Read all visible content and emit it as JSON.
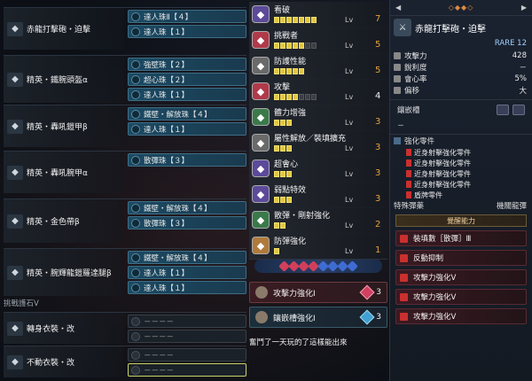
{
  "left": {
    "rows": [
      {
        "name": "赤龍打擊砲・迫擊",
        "icon": "gunlance-icon",
        "jewels": [
          {
            "label": "達人珠Ⅱ【４】",
            "empty": false
          },
          {
            "label": "達人珠【１】",
            "empty": false
          }
        ]
      },
      {
        "name": "精英・鐵腕頭盔α",
        "icon": "helm-icon",
        "jewels": [
          {
            "label": "強壁珠【２】",
            "empty": false
          },
          {
            "label": "超心珠【２】",
            "empty": false
          },
          {
            "label": "達人珠【１】",
            "empty": false
          }
        ]
      },
      {
        "name": "精英・轟吼鎧甲β",
        "icon": "chest-icon",
        "jewels": [
          {
            "label": "鐵壁・解放珠【４】",
            "empty": false
          },
          {
            "label": "達人珠【１】",
            "empty": false
          }
        ]
      },
      {
        "name": "精英・轟吼腕甲α",
        "icon": "arms-icon",
        "jewels": [
          {
            "label": "散彈珠【３】",
            "empty": false
          }
        ]
      },
      {
        "name": "精英・金色帶β",
        "icon": "waist-icon",
        "jewels": [
          {
            "label": "鐵壁・解放珠【４】",
            "empty": false
          },
          {
            "label": "散彈珠【３】",
            "empty": false
          }
        ]
      },
      {
        "name": "精英・腕輝龍鎧羅達腿β",
        "icon": "legs-icon",
        "jewels": [
          {
            "label": "鐵壁・解放珠【４】",
            "empty": false
          },
          {
            "label": "達人珠【１】",
            "empty": false
          },
          {
            "label": "達人珠【１】",
            "empty": false
          }
        ]
      }
    ],
    "charm_header": "挑戰護石Ⅴ",
    "layered": [
      {
        "name": "轉身衣裝・改",
        "slot": "－－－－",
        "slot2": "－－－－"
      },
      {
        "name": "不動衣裝・改",
        "slot": "－－－－",
        "slot2": "－－－－"
      }
    ]
  },
  "skills": [
    {
      "name": "看破",
      "level_label": "Lv",
      "level": "7",
      "pips": 7,
      "on": 7,
      "color": "#5c4a9a",
      "white": false
    },
    {
      "name": "挑戰者",
      "level_label": "Lv",
      "level": "5",
      "pips": 7,
      "on": 5,
      "color": "#b03a4a",
      "white": false
    },
    {
      "name": "防護性能",
      "level_label": "Lv",
      "level": "5",
      "pips": 5,
      "on": 5,
      "color": "#6a6a6a",
      "white": false
    },
    {
      "name": "攻擊",
      "level_label": "Lv",
      "level": "4",
      "pips": 7,
      "on": 4,
      "color": "#b03a4a",
      "white": true
    },
    {
      "name": "體力增強",
      "level_label": "Lv",
      "level": "3",
      "pips": 3,
      "on": 3,
      "color": "#3a7a4a",
      "white": false
    },
    {
      "name": "屬性解放／裝填擴充",
      "level_label": "Lv",
      "level": "3",
      "pips": 3,
      "on": 3,
      "color": "#6a6a6a",
      "white": false
    },
    {
      "name": "超會心",
      "level_label": "Lv",
      "level": "3",
      "pips": 3,
      "on": 3,
      "color": "#5c4a9a",
      "white": false
    },
    {
      "name": "弱點特效",
      "level_label": "Lv",
      "level": "3",
      "pips": 3,
      "on": 3,
      "color": "#5c4a9a",
      "white": false
    },
    {
      "name": "散彈・剛射強化",
      "level_label": "Lv",
      "level": "2",
      "pips": 2,
      "on": 2,
      "color": "#3a7a4a",
      "white": false
    },
    {
      "name": "防彈強化",
      "level_label": "Lv",
      "level": "1",
      "pips": 1,
      "on": 1,
      "color": "#b07a3a",
      "white": false
    }
  ],
  "bonuses": [
    {
      "label": "攻擊力強化Ⅰ",
      "count": "3",
      "color": "red"
    },
    {
      "label": "鑲嵌槽強化Ⅰ",
      "count": "3",
      "color": "blue"
    }
  ],
  "caption": "奮鬥了一天玩的了這樣能出來",
  "right": {
    "top_left": "◀",
    "top_dots": "◇◆◆◇",
    "top_right": "▶",
    "weapon_name": "赤龍打擊砲・迫擊",
    "rarity": "RARE 12",
    "stats": [
      {
        "label": "攻擊力",
        "value": "428"
      },
      {
        "label": "銳利度",
        "value": "－"
      },
      {
        "label": "會心率",
        "value": "5%"
      },
      {
        "label": "偏移",
        "value": "大"
      }
    ],
    "slot_label": "鑲嵌槽",
    "slot_dash": "－",
    "aug_header": "強化零件",
    "parts": [
      "近身射擊強化零件",
      "近身射擊強化零件",
      "近身射擊強化零件",
      "近身射擊強化零件",
      "盾牌零件"
    ],
    "special_label": "特殊彈藥",
    "special_value": "機關龍彈",
    "special_btn": "覺醒能力",
    "augments": [
      "裝填數［散彈］Ⅲ",
      "反動抑制",
      "攻擊力強化Ⅴ",
      "攻擊力強化Ⅴ",
      "攻擊力強化Ⅴ"
    ]
  }
}
